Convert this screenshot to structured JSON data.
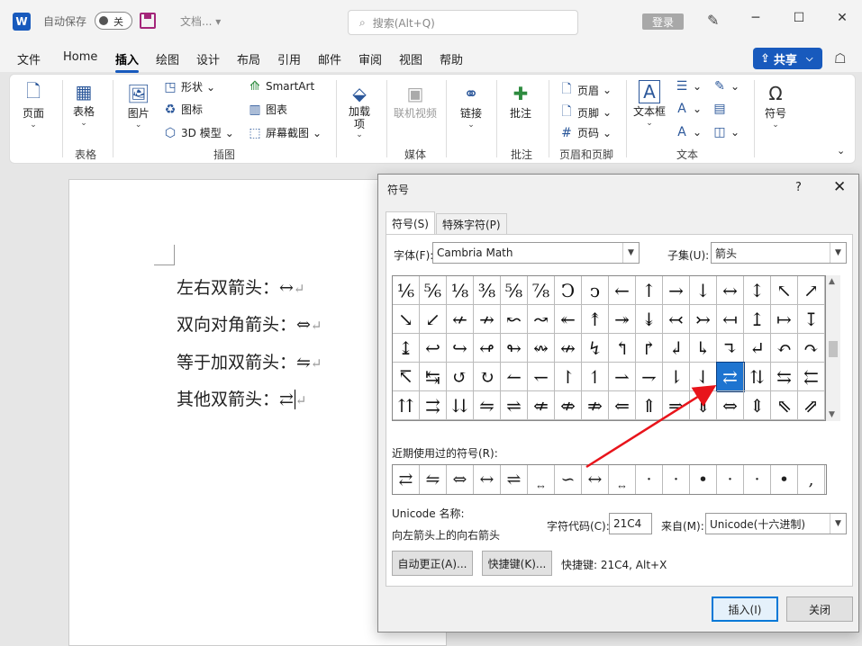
{
  "titlebar": {
    "logo": "W",
    "autosave_label": "自动保存",
    "autosave_state": "关",
    "doc_name": "文档... ▾",
    "search_placeholder": "搜索(Alt+Q)",
    "login": "登录"
  },
  "menu": [
    "文件",
    "Home",
    "插入",
    "绘图",
    "设计",
    "布局",
    "引用",
    "邮件",
    "审阅",
    "视图",
    "帮助"
  ],
  "menu_active": "插入",
  "share": "共享",
  "ribbon": {
    "page": "页面",
    "table": "表格",
    "table_group": "表格",
    "picture": "图片",
    "shapes": "形状",
    "icons": "图标",
    "model3d": "3D 模型",
    "smartart": "SmartArt",
    "chart": "图表",
    "screenshot": "屏幕截图",
    "illustrations_group": "插图",
    "addins": "加载\n项",
    "online_video": "联机视频",
    "media_group": "媒体",
    "link": "链接",
    "comment": "批注",
    "comment_group": "批注",
    "header": "页眉",
    "footer": "页脚",
    "page_number": "页码",
    "header_footer_group": "页眉和页脚",
    "textbox": "文本框",
    "text_group": "文本",
    "symbol": "符号"
  },
  "document": {
    "lines": [
      "左右双箭头：↔",
      "双向对角箭头：⇔",
      "等于加双箭头：⇋",
      "其他双箭头：⇄"
    ]
  },
  "dialog": {
    "title": "符号",
    "help": "?",
    "tab_symbols": "符号(S)",
    "tab_special": "特殊字符(P)",
    "font_label": "字体(F):",
    "font_value": "Cambria Math",
    "subset_label": "子集(U):",
    "subset_value": "箭头",
    "grid_rows": [
      [
        "⅙",
        "⅚",
        "⅛",
        "⅜",
        "⅝",
        "⅞",
        "Ↄ",
        "ↄ",
        "←",
        "↑",
        "→",
        "↓",
        "↔",
        "↕",
        "↖",
        "↗"
      ],
      [
        "↘",
        "↙",
        "↚",
        "↛",
        "↜",
        "↝",
        "↞",
        "↟",
        "↠",
        "↡",
        "↢",
        "↣",
        "↤",
        "↥",
        "↦",
        "↧"
      ],
      [
        "↨",
        "↩",
        "↪",
        "↫",
        "↬",
        "↭",
        "↮",
        "↯",
        "↰",
        "↱",
        "↲",
        "↳",
        "↴",
        "↵",
        "↶",
        "↷"
      ],
      [
        "↸",
        "↹",
        "↺",
        "↻",
        "↼",
        "↽",
        "↾",
        "↿",
        "⇀",
        "⇁",
        "⇂",
        "⇃",
        "⇄",
        "⇅",
        "⇆",
        "⇇"
      ],
      [
        "⇈",
        "⇉",
        "⇊",
        "⇋",
        "⇌",
        "⇍",
        "⇎",
        "⇏",
        "⇐",
        "⇑",
        "⇒",
        "⇓",
        "⇔",
        "⇕",
        "⇖",
        "⇗"
      ]
    ],
    "selected_row": 3,
    "selected_col": 12,
    "recent_label": "近期使用过的符号(R):",
    "recent": [
      "⇄",
      "⇋",
      "⇔",
      "↔",
      "⇌",
      "↔",
      "∽",
      "↔",
      "↔",
      "·",
      "·",
      "•",
      "·",
      "·",
      "•",
      ","
    ],
    "unicode_name_label": "Unicode 名称:",
    "unicode_name": "向左箭头上的向右箭头",
    "char_code_label": "字符代码(C):",
    "char_code": "21C4",
    "from_label": "来自(M):",
    "from_value": "Unicode(十六进制)",
    "autocorrect_btn": "自动更正(A)...",
    "shortcut_btn": "快捷键(K)...",
    "shortcut_text": "快捷键: 21C4, Alt+X",
    "insert_btn": "插入(I)",
    "close_btn": "关闭"
  }
}
